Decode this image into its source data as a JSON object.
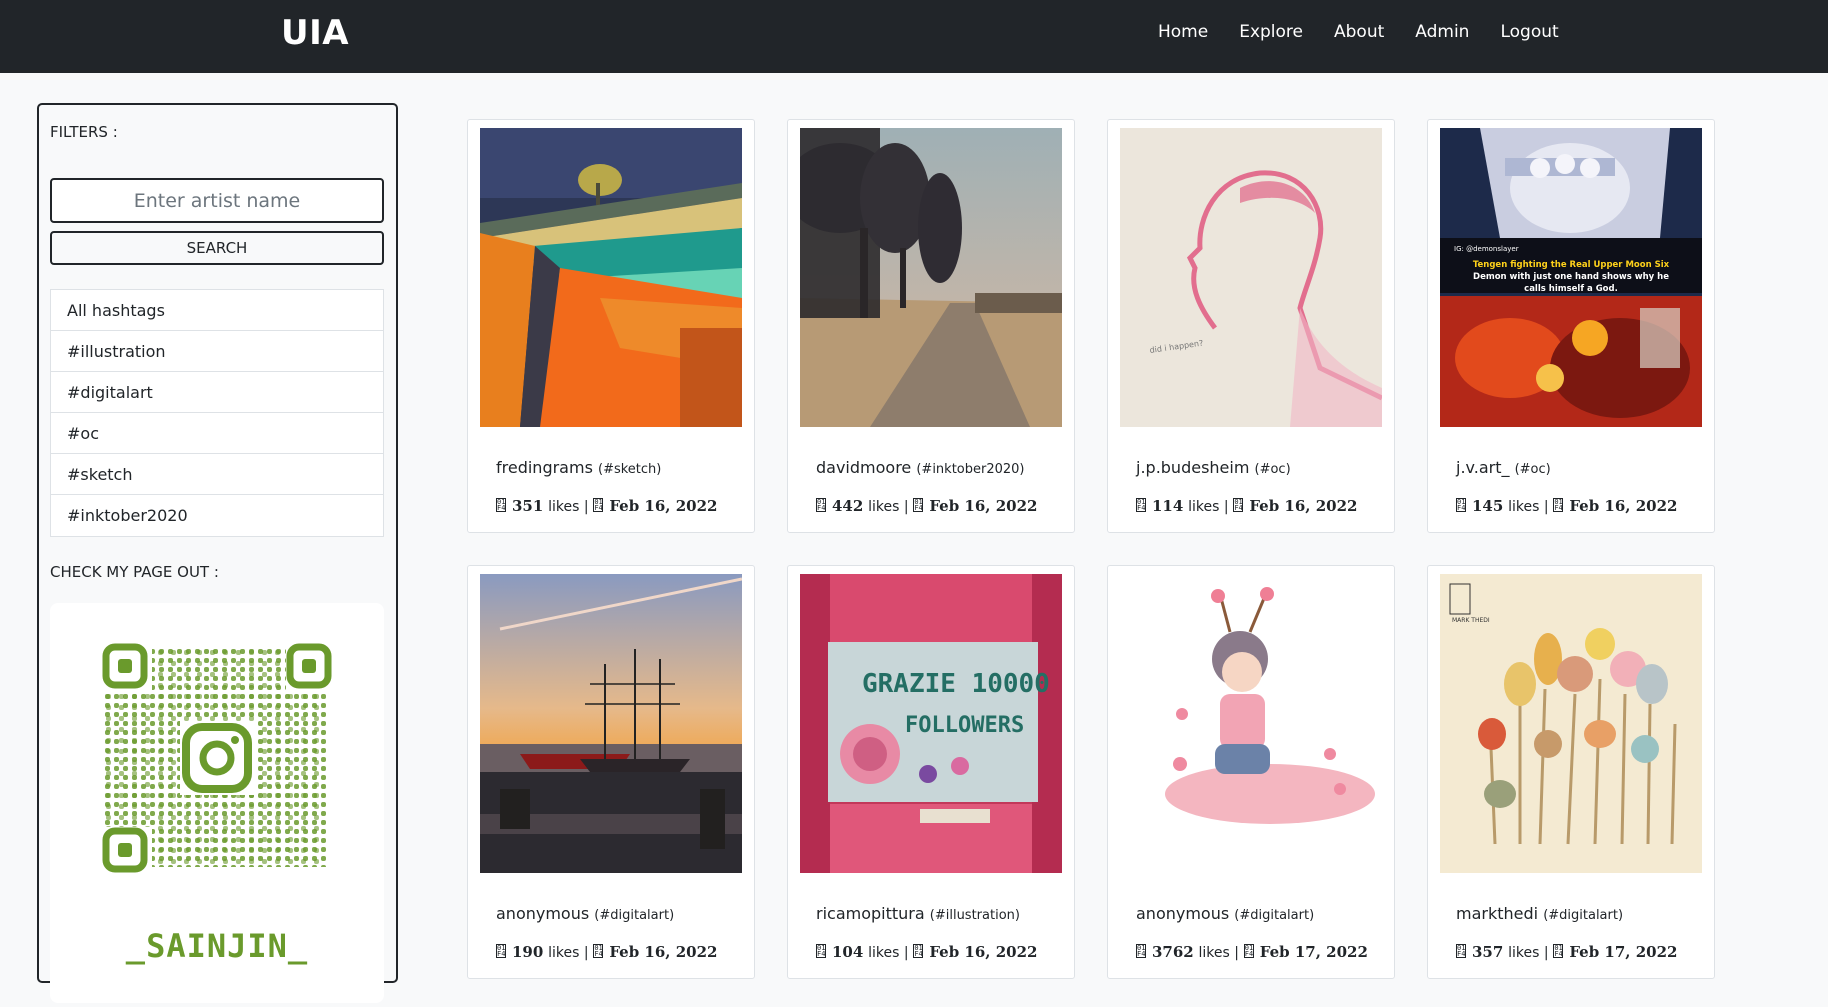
{
  "nav": {
    "brand": "UIA",
    "links": [
      "Home",
      "Explore",
      "About",
      "Admin",
      "Logout"
    ]
  },
  "sidebar": {
    "filters_label": "FILTERS :",
    "artist_placeholder": "Enter artist name",
    "search_label": "SEARCH",
    "hashtags": [
      "All hashtags",
      "#illustration",
      "#digitalart",
      "#oc",
      "#sketch",
      "#inktober2020"
    ],
    "check_page_label": "CHECK MY PAGE OUT :",
    "qr_caption": "_SAINJIN_"
  },
  "colors": {
    "navbar": "#212529",
    "qr_green": "#6a9a2c",
    "background": "#f8f9fa"
  },
  "posts": [
    {
      "artist": "fredingrams",
      "tag": "(#sketch)",
      "likes": "351",
      "likes_label": "likes |",
      "date": "Feb 16, 2022"
    },
    {
      "artist": "davidmoore",
      "tag": "(#inktober2020)",
      "likes": "442",
      "likes_label": "likes |",
      "date": "Feb 16, 2022"
    },
    {
      "artist": "j.p.budesheim",
      "tag": "(#oc)",
      "likes": "114",
      "likes_label": "likes |",
      "date": "Feb 16, 2022"
    },
    {
      "artist": "j.v.art_",
      "tag": "(#oc)",
      "likes": "145",
      "likes_label": "likes |",
      "date": "Feb 16, 2022"
    },
    {
      "artist": "anonymous",
      "tag": "(#digitalart)",
      "likes": "190",
      "likes_label": "likes |",
      "date": "Feb 16, 2022"
    },
    {
      "artist": "ricamopittura",
      "tag": "(#illustration)",
      "likes": "104",
      "likes_label": "likes |",
      "date": "Feb 16, 2022"
    },
    {
      "artist": "anonymous",
      "tag": "(#digitalart)",
      "likes": "3762",
      "likes_label": "likes |",
      "date": "Feb 17, 2022"
    },
    {
      "artist": "markthedi",
      "tag": "(#digitalart)",
      "likes": "357",
      "likes_label": "likes |",
      "date": "Feb 17, 2022"
    }
  ],
  "image_text": {
    "demon_tag": "IG: @demonslayer",
    "demon_line1": "Tengen fighting the Real Upper Moon Six",
    "demon_line2": "Demon with just one hand shows why he",
    "demon_line3": "calls himself a God.",
    "sketch_note": "did i happen?",
    "embroidery_line1": "GRAZIE 10000",
    "embroidery_line2": "FOLLOWERS",
    "mark_signature": "MARK THEDI"
  }
}
